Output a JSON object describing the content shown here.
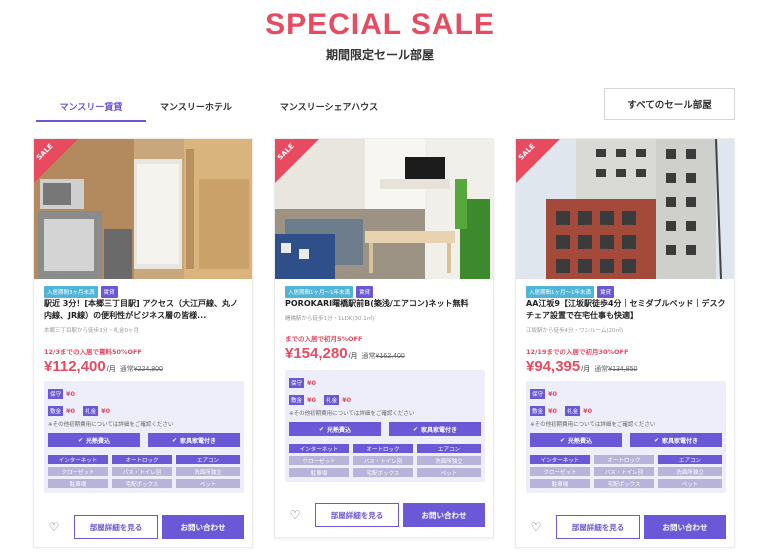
{
  "hero": {
    "title": "SPECIAL SALE",
    "subtitle": "期間限定セール部屋"
  },
  "tabs": [
    {
      "label": "マンスリー賃貸",
      "active": true
    },
    {
      "label": "マンスリーホテル",
      "active": false
    },
    {
      "label": "マンスリーシェアハウス",
      "active": false
    }
  ],
  "all_sale_button": "すべてのセール部屋",
  "common": {
    "sale_ribbon": "SALE",
    "fee_labels": {
      "key_money": "敷金",
      "gift_money": "礼金",
      "cleaning": "保守"
    },
    "fee_note": "※その他初期費用については詳細をご確認ください",
    "features": [
      "光熱費込",
      "家具家電付き"
    ],
    "tags": [
      "インターネット",
      "オートロック",
      "エアコン",
      "クローゼット",
      "バス・トイレ別",
      "洗面所独立",
      "駐車場",
      "宅配ボックス",
      "ペット"
    ],
    "detail_button": "部屋詳細を見る",
    "contact_button": "お問い合わせ",
    "price_unit": "/月",
    "old_price_prefix": "通常"
  },
  "cards": [
    {
      "badges": [
        "入居期間3ヶ月未満",
        "賃貸"
      ],
      "title": "駅近 3分！[本郷三丁目駅] アクセス（大江戸線、丸ノ内線、JR線）の便利性がビジネス層の皆様...",
      "access": "本郷三丁目駅から徒歩3分・礼金0ヶ月",
      "promo": "12/3までの入居で賃料50%OFF",
      "price": "¥112,400",
      "old_price": "¥224,800",
      "cleaning": "¥0",
      "key_money": "¥0",
      "gift_money": "¥0",
      "tags_on": [
        true,
        true,
        true,
        false,
        false,
        false,
        false,
        false,
        false
      ]
    },
    {
      "badges": [
        "入居期間1ヶ月～1年未満",
        "賃貸"
      ],
      "title": "POROKARI曙橋駅前B(築浅/エアコン)ネット無料",
      "access": "曙橋駅から徒歩1分・1LDK(30.1㎡)",
      "promo": "までの入居で初月5%OFF",
      "price": "¥154,280",
      "old_price": "¥162,400",
      "cleaning": "¥0",
      "key_money": "¥0",
      "gift_money": "¥0",
      "tags_on": [
        true,
        true,
        true,
        false,
        false,
        false,
        false,
        false,
        false
      ]
    },
    {
      "badges": [
        "入居期間1ヶ月～1年未満",
        "賃貸"
      ],
      "title": "AA江坂9【江坂駅徒歩4分｜セミダブルベッド｜デスクチェア設置で在宅仕事も快適】",
      "access": "江坂駅から徒歩4分・ワンルーム(20㎡)",
      "promo": "12/19までの入居で初月30%OFF",
      "price": "¥94,395",
      "old_price": "¥134,850",
      "cleaning": "¥0",
      "key_money": "¥0",
      "gift_money": "¥0",
      "tags_on": [
        true,
        false,
        true,
        false,
        false,
        false,
        false,
        false,
        false
      ]
    }
  ]
}
